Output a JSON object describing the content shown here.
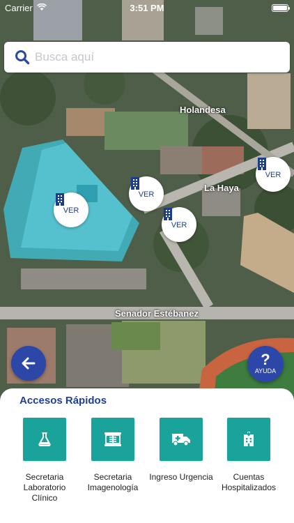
{
  "status_bar": {
    "carrier": "Carrier",
    "time": "3:51 PM"
  },
  "search": {
    "placeholder": "Busca aquí"
  },
  "map": {
    "street_labels": [
      "Holandesa",
      "La Haya",
      "Senador Estébanez"
    ],
    "pin_label": "VER",
    "pin_icon": "building-icon"
  },
  "help_button": {
    "symbol": "?",
    "label": "AYUDA"
  },
  "quick_access": {
    "title": "Accesos Rápidos",
    "items": [
      {
        "label": "Secretaria Laboratorio Clínico",
        "icon": "flask-icon"
      },
      {
        "label": "Secretaria Imagenología",
        "icon": "xray-icon"
      },
      {
        "label": "Ingreso Urgencia",
        "icon": "ambulance-icon"
      },
      {
        "label": "Cuentas Hospitalizados",
        "icon": "hospital-icon"
      }
    ]
  },
  "colors": {
    "primary": "#2c47a8",
    "accent_teal": "#1aa39a",
    "title_blue": "#1f3e97"
  }
}
